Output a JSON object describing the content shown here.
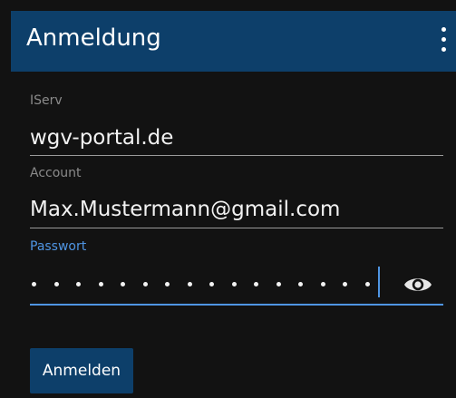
{
  "app_bar": {
    "title": "Anmeldung",
    "menu_icon": "more-vertical-icon"
  },
  "form": {
    "iserv": {
      "label": "IServ",
      "value": "wgv-portal.de"
    },
    "account": {
      "label": "Account",
      "value": "Max.Mustermann@gmail.com"
    },
    "password": {
      "label": "Passwort",
      "masked_length": 16,
      "toggle_icon": "eye-icon"
    }
  },
  "login_button": {
    "label": "Anmelden"
  },
  "colors": {
    "app_bar": "#0d3f6a",
    "background": "#121212",
    "accent": "#4f95e3"
  }
}
